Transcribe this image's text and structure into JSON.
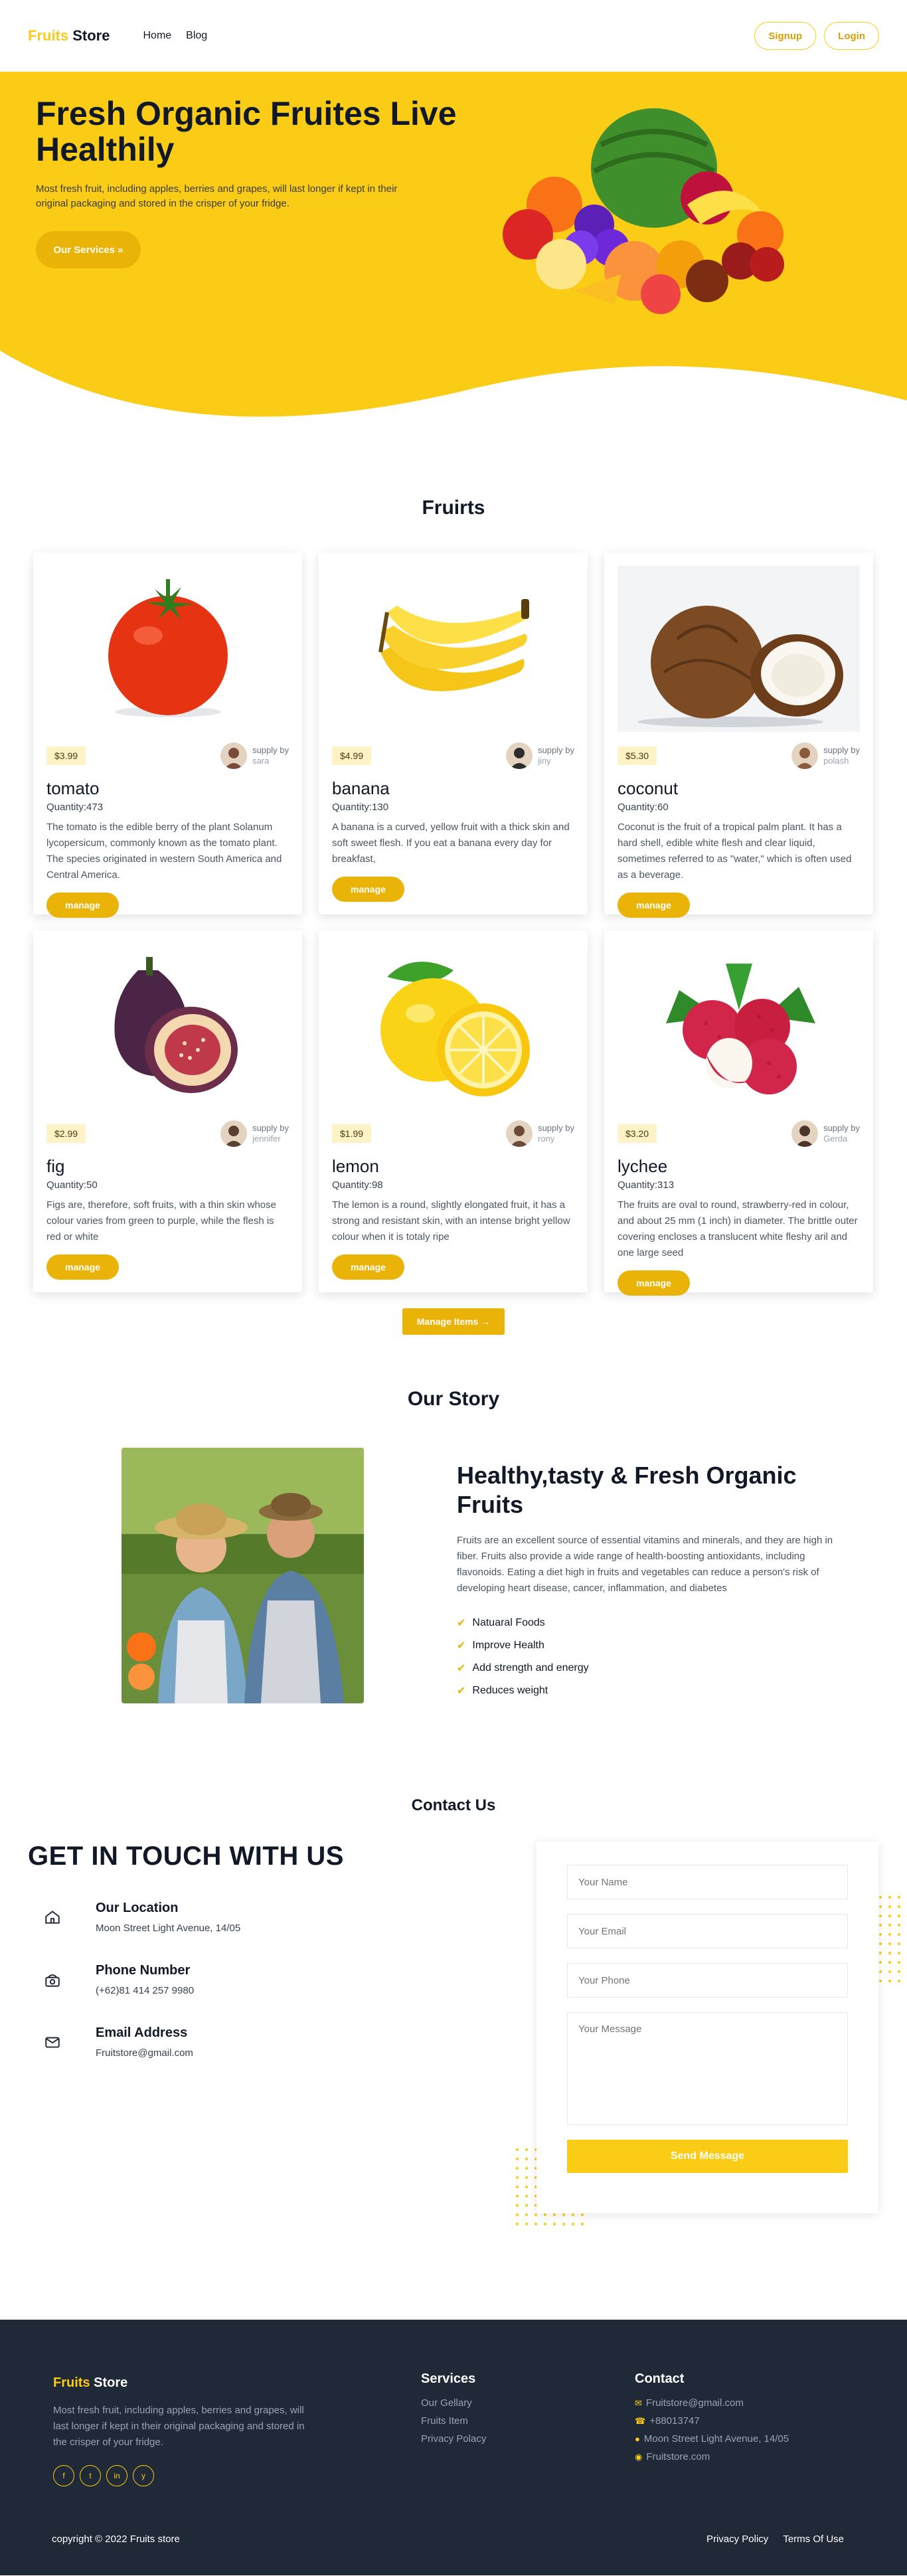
{
  "nav": {
    "brand_accent": "Fruits",
    "brand_rest": " Store",
    "links": [
      "Home",
      "Blog"
    ],
    "signup": "Signup",
    "login": "Login"
  },
  "hero": {
    "title": "Fresh Organic Fruites Live Healthily",
    "text": "Most fresh fruit, including apples, berries and grapes, will last longer if kept in their original packaging and stored in the crisper of your fridge.",
    "cta": "Our Services »"
  },
  "products": {
    "title": "Fruirts",
    "supply_label": "supply by",
    "manage_label": "manage",
    "manage_items": "Manage Items",
    "items": [
      {
        "name": "tomato",
        "price": "$3.99",
        "supplier": "sara",
        "quantity": "Quantity:473",
        "description": "The tomato is the edible berry of the plant Solanum lycopersicum, commonly known as the tomato plant. The species originated in western South America and Central America.",
        "icon": "tomato-image"
      },
      {
        "name": "banana",
        "price": "$4.99",
        "supplier": "jiny",
        "quantity": "Quantity:130",
        "description": "A banana is a curved, yellow fruit with a thick skin and soft sweet flesh. If you eat a banana every day for breakfast,",
        "icon": "banana-image"
      },
      {
        "name": "coconut",
        "price": "$5.30",
        "supplier": "polash",
        "quantity": "Quantity:60",
        "description": "Coconut is the fruit of a tropical palm plant. It has a hard shell, edible white flesh and clear liquid, sometimes referred to as \"water,\" which is often used as a beverage.",
        "icon": "coconut-image"
      },
      {
        "name": "fig",
        "price": "$2.99",
        "supplier": "jennifer",
        "quantity": "Quantity:50",
        "description": "Figs are, therefore, soft fruits, with a thin skin whose colour varies from green to purple, while the flesh is red or white",
        "icon": "fig-image"
      },
      {
        "name": "lemon",
        "price": "$1.99",
        "supplier": "rony",
        "quantity": "Quantity:98",
        "description": "The lemon is a round, slightly elongated fruit, it has a strong and resistant skin, with an intense bright yellow colour when it is totaly ripe",
        "icon": "lemon-image"
      },
      {
        "name": "lychee",
        "price": "$3.20",
        "supplier": "Gerda",
        "quantity": "Quantity:313",
        "description": "The fruits are oval to round, strawberry-red in colour, and about 25 mm (1 inch) in diameter. The brittle outer covering encloses a translucent white fleshy aril and one large seed",
        "icon": "lychee-image"
      }
    ]
  },
  "story": {
    "title": "Our Story",
    "heading": "Healthy,tasty & Fresh Organic Fruits",
    "text": "Fruits are an excellent source of essential vitamins and minerals, and they are high in fiber. Fruits also provide a wide range of health-boosting antioxidants, including flavonoids. Eating a diet high in fruits and vegetables can reduce a person's risk of developing heart disease, cancer, inflammation, and diabetes",
    "points": [
      "Natuaral Foods",
      "Improve Health",
      "Add strength and energy",
      "Reduces weight"
    ]
  },
  "contact": {
    "title": "Contact Us",
    "heading": "GET IN TOUCH WITH US",
    "location_label": "Our Location",
    "location_value": "Moon Street Light Avenue, 14/05",
    "phone_label": "Phone Number",
    "phone_value": "(+62)81 414 257 9980",
    "email_label": "Email Address",
    "email_value": "Fruitstore@gmail.com",
    "form": {
      "name_placeholder": "Your Name",
      "email_placeholder": "Your Email",
      "phone_placeholder": "Your Phone",
      "message_placeholder": "Your Message",
      "send": "Send Message"
    }
  },
  "footer": {
    "brand_accent": "Fruits",
    "brand_rest": " Store",
    "text": "Most fresh fruit, including apples, berries and grapes, will last longer if kept in their original packaging and stored in the crisper of your fridge.",
    "socials": [
      "f",
      "t",
      "in",
      "y"
    ],
    "services_title": "Services",
    "services": [
      "Our Gellary",
      "Fruits Item",
      "Privacy Polacy"
    ],
    "contact_title": "Contact",
    "contact_items": [
      "Fruitstore@gmail.com",
      "+88013747",
      "Moon Street Light Avenue, 14/05",
      "Fruitstore.com"
    ],
    "copyright": "copyright © 2022 Fruits store",
    "privacy": "Privacy Policy",
    "terms": "Terms Of Use"
  },
  "colors": {
    "accent": "#facc15",
    "accent_dark": "#eab308",
    "footer_bg": "#1f2937"
  }
}
